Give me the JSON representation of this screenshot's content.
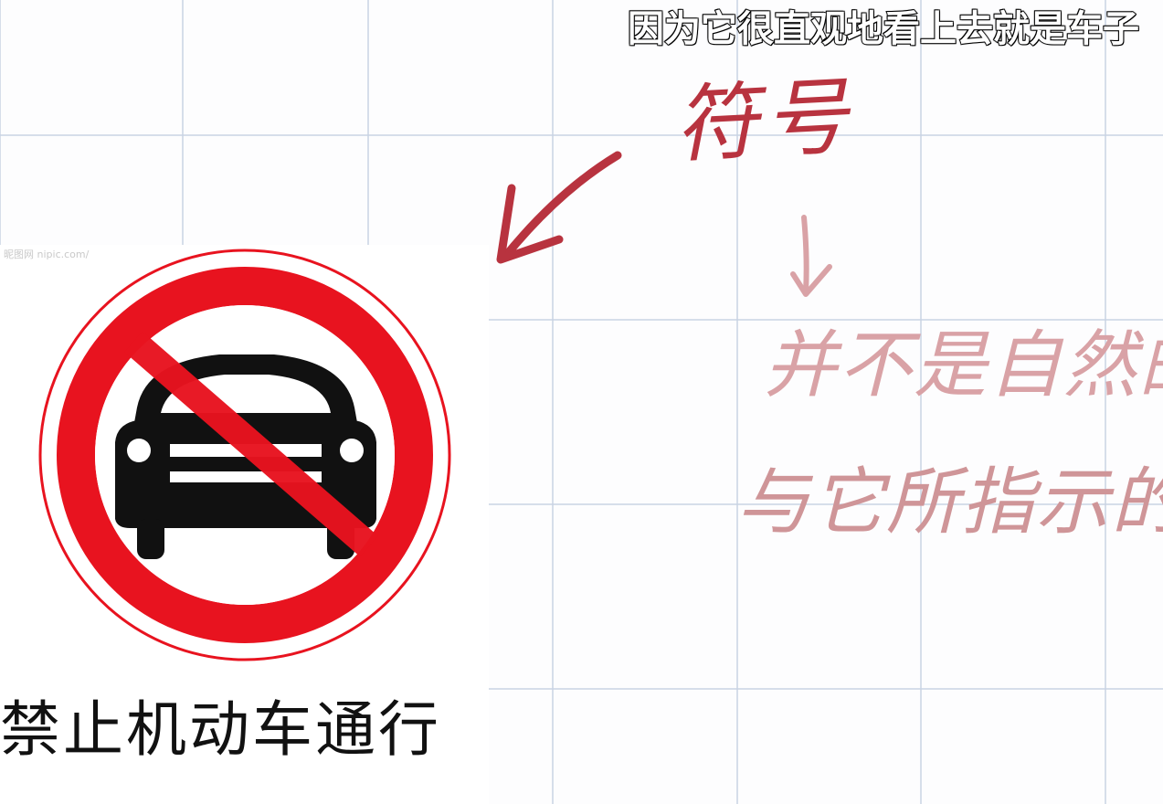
{
  "subtitle": "因为它很直观地看上去就是车子",
  "sign": {
    "watermark": "昵图网 nipic.com/",
    "caption": "禁止机动车通行",
    "ring_color": "#e8131f",
    "symbol_color": "#111111"
  },
  "annotations": {
    "symbol_word": "符号",
    "line1": "并不是自然的",
    "line2": "与它所指示的",
    "primary_ink": "#b8333f",
    "faded_ink": "#d9a2a6"
  },
  "grid_color": "#c9d3e3"
}
